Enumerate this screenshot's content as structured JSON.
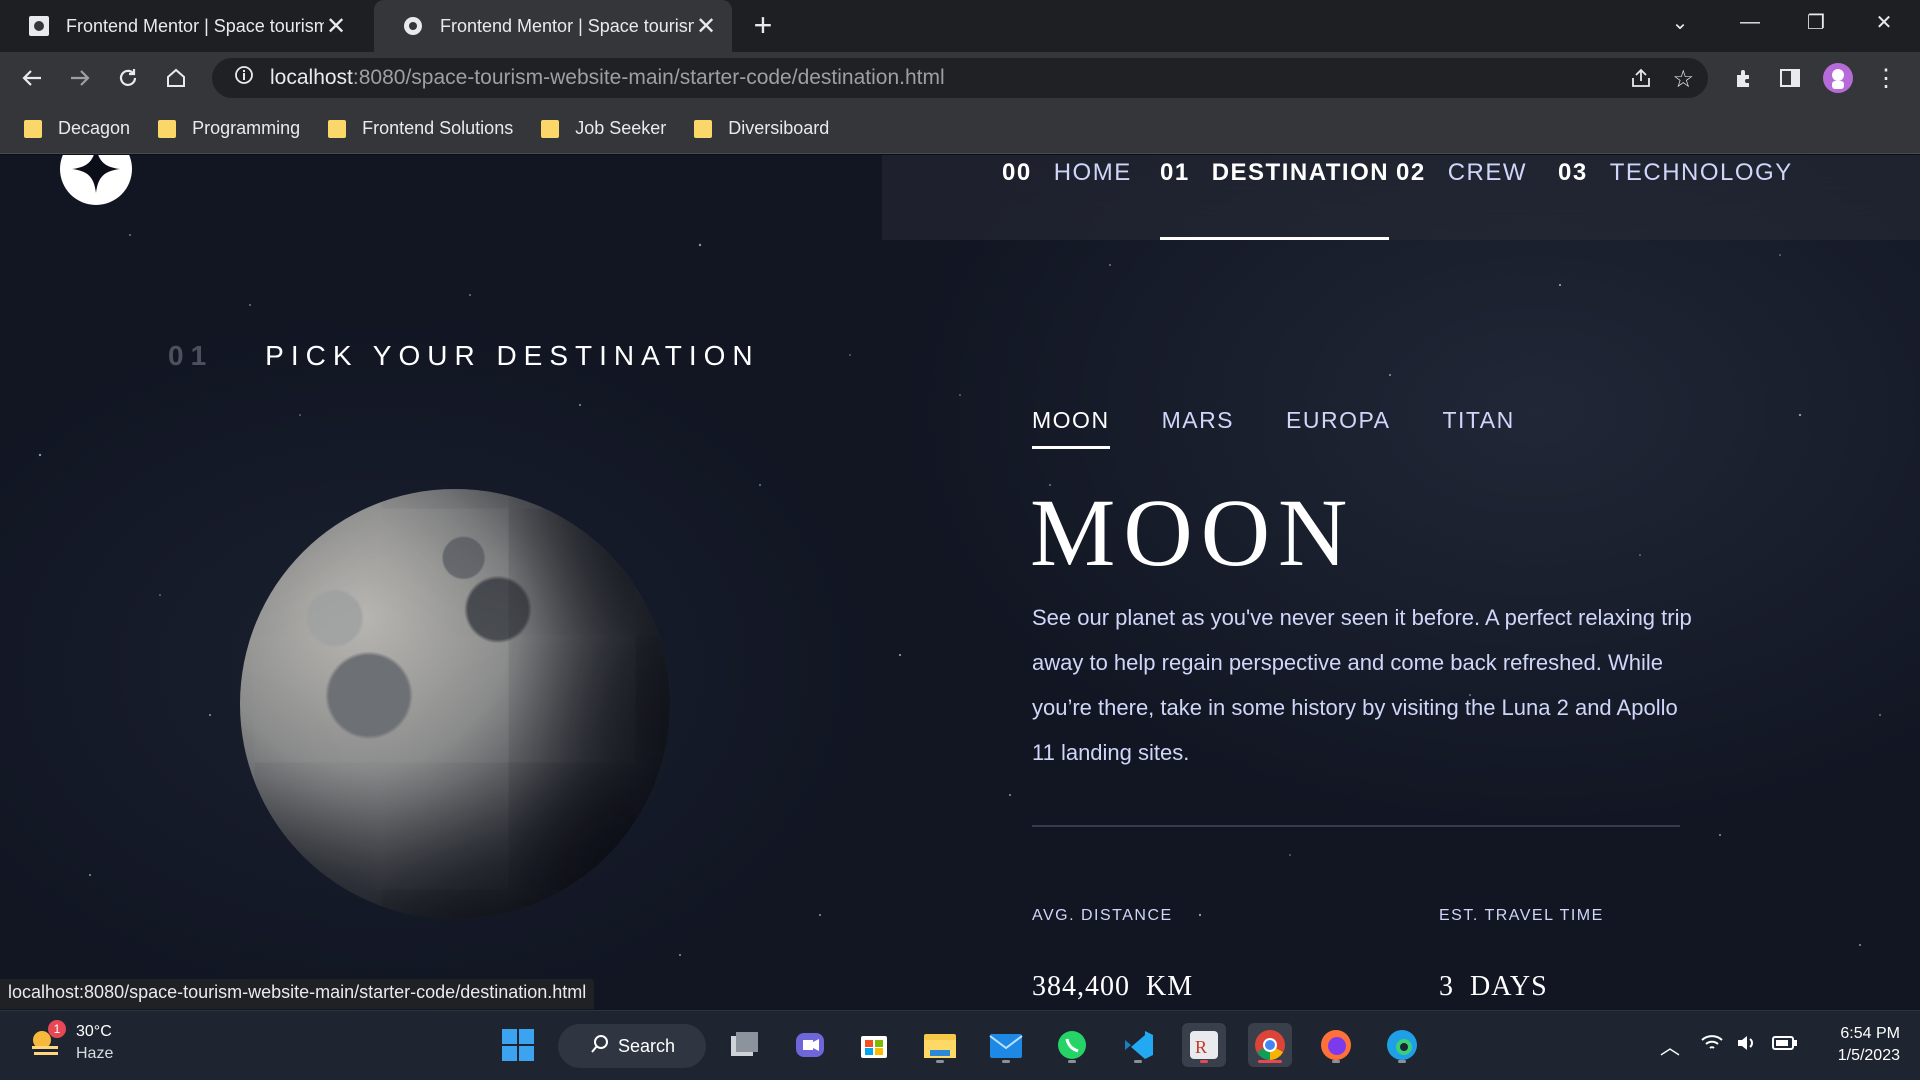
{
  "browser": {
    "tabs": [
      {
        "title": "Frontend Mentor | Space tourism website",
        "active": false
      },
      {
        "title": "Frontend Mentor | Space tourism website",
        "active": true
      }
    ],
    "url_host": "localhost",
    "url_path": ":8080/space-tourism-website-main/starter-code/destination.html",
    "bookmarks": [
      "Decagon",
      "Programming",
      "Frontend Solutions",
      "Job Seeker",
      "Diversiboard"
    ],
    "status_url": "localhost:8080/space-tourism-website-main/starter-code/destination.html"
  },
  "site": {
    "nav": [
      {
        "num": "00",
        "label": "HOME",
        "active": false
      },
      {
        "num": "01",
        "label": "DESTINATION",
        "active": true
      },
      {
        "num": "02",
        "label": "CREW",
        "active": false
      },
      {
        "num": "03",
        "label": "TECHNOLOGY",
        "active": false
      }
    ],
    "heading_num": "01",
    "heading": "PICK YOUR DESTINATION",
    "destination_tabs": [
      "MOON",
      "MARS",
      "EUROPA",
      "TITAN"
    ],
    "active_destination": "MOON",
    "name": "MOON",
    "description": "See our planet as you've never seen it before. A perfect relaxing trip away to help regain perspective and come back refreshed. While you’re there, take in some history by visiting the Luna 2 and Apollo 11 landing sites.",
    "stats": [
      {
        "label": "AVG. DISTANCE",
        "value": "384,400  KM"
      },
      {
        "label": "EST. TRAVEL TIME",
        "value": "3  DAYS"
      }
    ]
  },
  "taskbar": {
    "weather_temp": "30°C",
    "weather_desc": "Haze",
    "weather_badge": "1",
    "search_label": "Search",
    "time": "6:54 PM",
    "date": "1/5/2023"
  }
}
